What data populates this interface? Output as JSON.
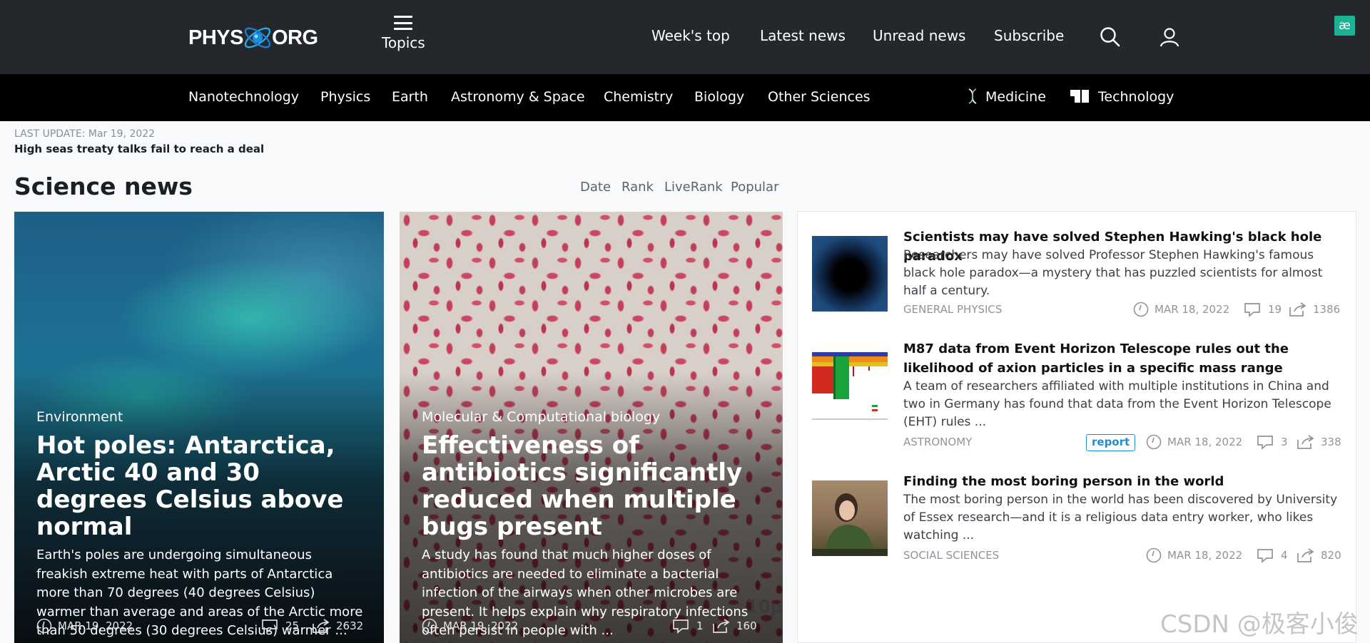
{
  "header": {
    "logo_left": "PHYS",
    "logo_right": "ORG",
    "topics_label": "Topics",
    "nav": [
      "Week's top",
      "Latest news",
      "Unread news",
      "Subscribe"
    ],
    "ae_badge": "æ"
  },
  "categories": [
    "Nanotechnology",
    "Physics",
    "Earth",
    "Astronomy & Space",
    "Chemistry",
    "Biology",
    "Other Sciences",
    "Medicine",
    "Technology"
  ],
  "last_update": {
    "label": "LAST UPDATE:",
    "date": "Mar 19, 2022",
    "headline": "High seas treaty talks fail to reach a deal"
  },
  "section": {
    "title": "Science news",
    "sort_tabs": [
      "Date",
      "Rank",
      "LiveRank",
      "Popular"
    ]
  },
  "feature_cards": [
    {
      "category": "Environment",
      "title": "Hot poles: Antarctica, Arctic 40 and 30 degrees Celsius above normal",
      "summary": "Earth's poles are undergoing simultaneous freakish extreme heat with parts of Antarctica more than 70 degrees (40 degrees Celsius) warmer than average and areas of the Arctic more than 50 degrees (30 degrees Celsius) warmer ...",
      "date": "MAR 19, 2022",
      "comments": "25",
      "shares": "2632"
    },
    {
      "category": "Molecular & Computational biology",
      "title": "Effectiveness of antibiotics significantly reduced when multiple bugs present",
      "summary": "A study has found that much higher doses of antibiotics are needed to eliminate a bacterial infection of the airways when other microbes are present. It helps explain why respiratory infections often persist in people with ...",
      "date": "MAR 19, 2022",
      "comments": "1",
      "shares": "160",
      "image_label": "10μ"
    }
  ],
  "news_list": [
    {
      "title": "Scientists may have solved Stephen Hawking's black hole paradox",
      "summary": "Researchers may have solved Professor Stephen Hawking's famous black hole paradox—a mystery that has puzzled scientists for almost half a century.",
      "category": "GENERAL PHYSICS",
      "date": "MAR 18, 2022",
      "comments": "19",
      "shares": "1386"
    },
    {
      "title": "M87 data from Event Horizon Telescope rules out the likelihood of axion particles in a specific mass range",
      "summary": "A team of researchers affiliated with multiple institutions in China and two in Germany has found that data from the Event Horizon Telescope (EHT) rules ...",
      "category": "ASTRONOMY",
      "badge": "report",
      "date": "MAR 18, 2022",
      "comments": "3",
      "shares": "338"
    },
    {
      "title": "Finding the most boring person in the world",
      "summary": "The most boring person in the world has been discovered by University of Essex research—and it is a religious data entry worker, who likes watching ...",
      "category": "SOCIAL SCIENCES",
      "date": "MAR 18, 2022",
      "comments": "4",
      "shares": "820"
    }
  ],
  "watermark": "CSDN @极客小俊",
  "colors": {
    "header_bg": "#24272c",
    "category_bar_bg": "#000000",
    "accent_blue": "#1e8fd0",
    "badge_green": "#1bb394"
  }
}
